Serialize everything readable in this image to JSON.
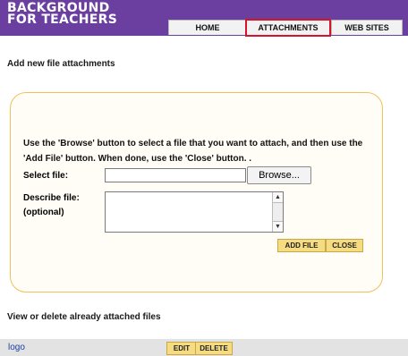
{
  "header": {
    "logo_line1": "BACKGROUND",
    "logo_line2": "FOR TEACHERS",
    "tabs": [
      {
        "label": "HOME"
      },
      {
        "label": "ATTACHMENTS"
      },
      {
        "label": "WEB SITES"
      }
    ],
    "active_tab": "ATTACHMENTS"
  },
  "add_section": {
    "heading": "Add new file attachments",
    "instructions": "Use the 'Browse' button to select a file that you want to attach, and then use the 'Add File' button. When done, use the 'Close' button. .",
    "select_file_label": "Select file:",
    "file_value": "",
    "browse_label": "Browse...",
    "describe_label": "Describe file:",
    "optional_label": "(optional)",
    "describe_value": "",
    "add_file_label": "ADD FILE",
    "close_label": "CLOSE"
  },
  "list_section": {
    "heading": "View or delete already attached files",
    "files": [
      {
        "name": "logo",
        "edit_label": "EDIT",
        "delete_label": "DELETE"
      }
    ]
  },
  "colors": {
    "banner": "#6a3fa0",
    "active_tab_border": "#d3152c",
    "panel_border": "#f0c05a",
    "action_button": "#f6dc80",
    "link": "#1a3fa3"
  }
}
